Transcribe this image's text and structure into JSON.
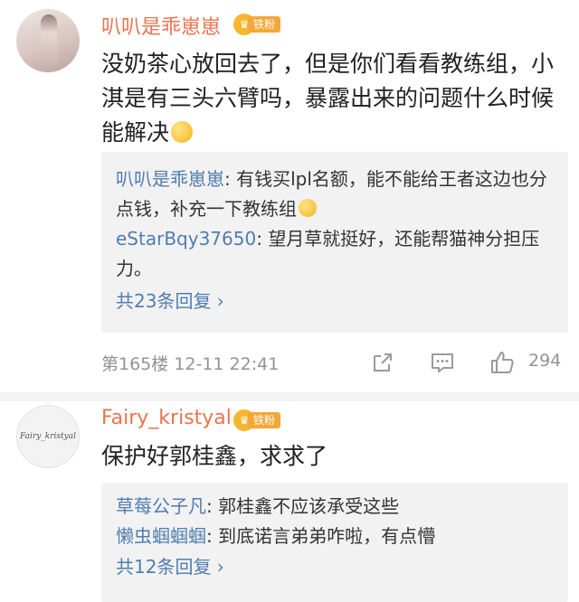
{
  "comments": [
    {
      "username": "叭叭是乖崽崽",
      "badge": "铁粉",
      "content": "没奶茶心放回去了，但是你们看看教练组，小淇是有三头六臂吗，暴露出来的问题什么时候能解决",
      "replies": [
        {
          "name": "叭叭是乖崽崽",
          "text": "有钱买lpl名额，能不能给王者这边也分点钱，补充一下教练组"
        },
        {
          "name": "eStarBqy37650",
          "text": "望月草就挺好，还能帮猫神分担压力。"
        }
      ],
      "more": "共23条回复 ›",
      "floor": "第165楼",
      "time": "12-11 22:41",
      "likes": "294"
    },
    {
      "username": "Fairy_kristyal",
      "badge": "铁粉",
      "avatar_text": "Fairy_kristyal",
      "content": "保护好郭桂鑫，求求了",
      "replies": [
        {
          "name": "草莓公子凡",
          "text": "郭桂鑫不应该承受这些"
        },
        {
          "name": "懒虫蝈蝈蝈",
          "text": "到底诺言弟弟咋啦，有点懵"
        }
      ],
      "more": "共12条回复 ›"
    }
  ],
  "colors": {
    "username": "#eb7350",
    "reply_name": "#507daf",
    "badge": "#f2a83a",
    "meta": "#939393"
  },
  "icons": [
    "share-icon",
    "comment-icon",
    "like-icon",
    "chevron-right-icon",
    "emoji-face-icon"
  ]
}
